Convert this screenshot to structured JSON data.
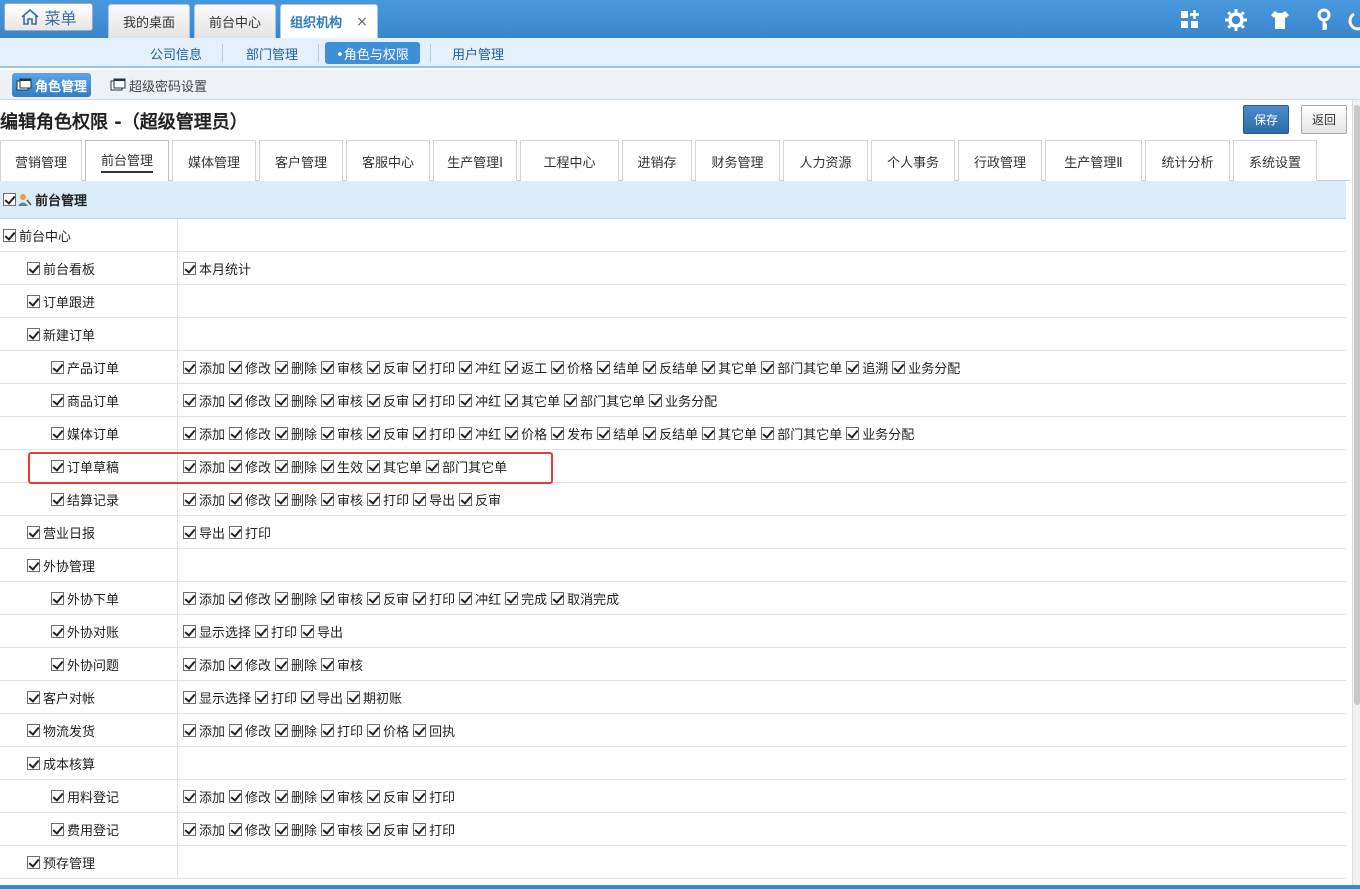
{
  "menu": {
    "label": "菜单"
  },
  "top_tabs": [
    {
      "label": "我的桌面"
    },
    {
      "label": "前台中心"
    },
    {
      "label": "组织机构",
      "close": "×"
    }
  ],
  "subnav": [
    "公司信息",
    "部门管理",
    "•角色与权限",
    "用户管理"
  ],
  "third_nav": [
    "角色管理",
    "超级密码设置"
  ],
  "page": {
    "title": "编辑角色权限 -（超级管理员）",
    "save": "保存",
    "back": "返回"
  },
  "module_tabs": [
    "营销管理",
    "前台管理",
    "媒体管理",
    "客户管理",
    "客服中心",
    "生产管理Ⅰ",
    "工程中心",
    "进销存",
    "财务管理",
    "人力资源",
    "个人事务",
    "行政管理",
    "生产管理Ⅱ",
    "统计分析",
    "系统设置"
  ],
  "section": {
    "label": "前台管理"
  },
  "rows": [
    {
      "label": "前台中心",
      "perms": []
    },
    {
      "label": "前台看板",
      "perms": [
        "本月统计"
      ]
    },
    {
      "label": "订单跟进",
      "perms": []
    },
    {
      "label": "新建订单",
      "perms": []
    },
    {
      "label": "产品订单",
      "perms": [
        "添加",
        "修改",
        "删除",
        "审核",
        "反审",
        "打印",
        "冲红",
        "返工",
        "价格",
        "结单",
        "反结单",
        "其它单",
        "部门其它单",
        "追溯",
        "业务分配"
      ]
    },
    {
      "label": "商品订单",
      "perms": [
        "添加",
        "修改",
        "删除",
        "审核",
        "反审",
        "打印",
        "冲红",
        "其它单",
        "部门其它单",
        "业务分配"
      ]
    },
    {
      "label": "媒体订单",
      "perms": [
        "添加",
        "修改",
        "删除",
        "审核",
        "反审",
        "打印",
        "冲红",
        "价格",
        "发布",
        "结单",
        "反结单",
        "其它单",
        "部门其它单",
        "业务分配"
      ]
    },
    {
      "label": "订单草稿",
      "perms": [
        "添加",
        "修改",
        "删除",
        "生效",
        "其它单",
        "部门其它单"
      ]
    },
    {
      "label": "结算记录",
      "perms": [
        "添加",
        "修改",
        "删除",
        "审核",
        "打印",
        "导出",
        "反审"
      ]
    },
    {
      "label": "营业日报",
      "perms": [
        "导出",
        "打印"
      ]
    },
    {
      "label": "外协管理",
      "perms": []
    },
    {
      "label": "外协下单",
      "perms": [
        "添加",
        "修改",
        "删除",
        "审核",
        "反审",
        "打印",
        "冲红",
        "完成",
        "取消完成"
      ]
    },
    {
      "label": "外协对账",
      "perms": [
        "显示选择",
        "打印",
        "导出"
      ]
    },
    {
      "label": "外协问题",
      "perms": [
        "添加",
        "修改",
        "删除",
        "审核"
      ]
    },
    {
      "label": "客户对帐",
      "perms": [
        "显示选择",
        "打印",
        "导出",
        "期初账"
      ]
    },
    {
      "label": "物流发货",
      "perms": [
        "添加",
        "修改",
        "删除",
        "打印",
        "价格",
        "回执"
      ]
    },
    {
      "label": "成本核算",
      "perms": []
    },
    {
      "label": "用料登记",
      "perms": [
        "添加",
        "修改",
        "删除",
        "审核",
        "反审",
        "打印"
      ]
    },
    {
      "label": "费用登记",
      "perms": [
        "添加",
        "修改",
        "删除",
        "审核",
        "反审",
        "打印"
      ]
    },
    {
      "label": "预存管理",
      "perms": []
    }
  ],
  "colors": {
    "accent": "#3a86cd",
    "highlight": "#e53a3a"
  }
}
